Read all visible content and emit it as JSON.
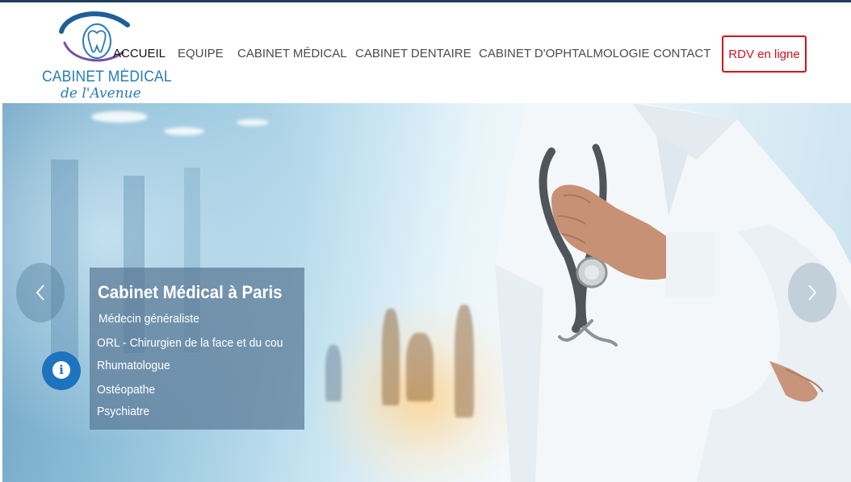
{
  "header": {
    "logo": {
      "line1": "CABINET MÉDICAL",
      "line2": "de l'Avenue",
      "icon": "tooth-logo-icon"
    },
    "nav": [
      {
        "label": "ACCUEIL",
        "active": true
      },
      {
        "label": "EQUIPE",
        "active": false
      },
      {
        "label": "CABINET MÉDICAL",
        "active": false
      },
      {
        "label": "CABINET DENTAIRE",
        "active": false
      },
      {
        "label": "CABINET D'OPHTALMOLOGIE",
        "active": false
      },
      {
        "label": "CONTACT",
        "active": false
      }
    ],
    "cta": {
      "label": "RDV en ligne",
      "color": "#d0141e"
    }
  },
  "hero": {
    "caption": {
      "title": "Cabinet Médical à Paris",
      "items": [
        "Médecin généraliste",
        "ORL - Chirurgien de la face et du cou",
        "Rhumatologue",
        "Ostéopathe",
        "Psychiatre"
      ]
    },
    "prev_icon": "chevron-left-icon",
    "next_icon": "chevron-right-icon"
  },
  "info_button": {
    "icon": "info-icon",
    "glyph": "i",
    "color": "#1e73be"
  },
  "colors": {
    "topbar": "#1d3f5e",
    "brand": "#2a7bb5",
    "accent": "#d0141e"
  }
}
